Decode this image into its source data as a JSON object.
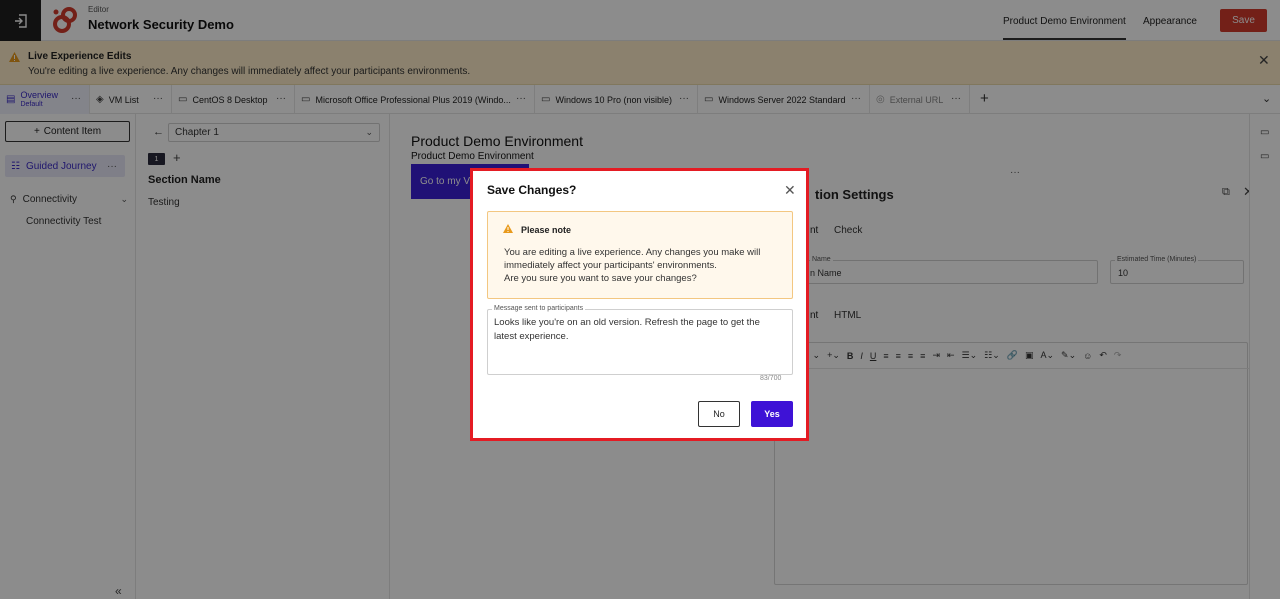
{
  "header": {
    "editor_label": "Editor",
    "title": "Network Security Demo",
    "tabs": [
      "Product Demo Environment",
      "Appearance"
    ],
    "save_label": "Save",
    "save_color": "#d13b2c"
  },
  "banner": {
    "title": "Live Experience Edits",
    "text": "You're editing a live experience. Any changes will immediately affect your participants environments."
  },
  "vm_tabs": [
    {
      "label": "Overview",
      "sub": "Default",
      "icon": "home-icon"
    },
    {
      "label": "VM List",
      "icon": "layers-icon"
    },
    {
      "label": "CentOS 8 Desktop",
      "icon": "monitor-icon"
    },
    {
      "label": "Microsoft Office Professional Plus 2019 (Windo...",
      "icon": "monitor-icon"
    },
    {
      "label": "Windows 10 Pro (non visible)",
      "icon": "monitor-icon"
    },
    {
      "label": "Windows Server 2022 Standard",
      "icon": "monitor-icon"
    },
    {
      "label": "External URL",
      "icon": "eye-off-icon"
    }
  ],
  "sidebar": {
    "content_button": "Content Item",
    "guided_journey": "Guided Journey",
    "connectivity": "Connectivity",
    "connectivity_test": "Connectivity Test"
  },
  "chapter": {
    "select_value": "Chapter 1",
    "page_number": "1",
    "section_label": "Section Name",
    "section_value": "Testing"
  },
  "preview": {
    "title": "Product Demo Environment",
    "subtitle": "Product Demo Environment",
    "button": "Go to my V"
  },
  "settings": {
    "title": "tion Settings",
    "tabs1": [
      "nt",
      "Check"
    ],
    "name_label": "Name",
    "name_value": "n Name",
    "est_label": "Estimated Time (Minutes)",
    "est_value": "10",
    "tabs2": [
      "nt",
      "HTML"
    ],
    "font_size": "5px"
  },
  "modal": {
    "title": "Save Changes?",
    "note_title": "Please note",
    "note_line1": "You are editing a live experience. Any changes you make will",
    "note_line2": "immediately affect your participants' environments.",
    "note_line3": "Are you sure you want to save your changes?",
    "message_label": "Message sent to participants",
    "message_value": "Looks like you're on an old version. Refresh the page to get the latest experience.",
    "counter": "83/700",
    "no_label": "No",
    "yes_label": "Yes",
    "highlight_color": "#e41b23",
    "accent_color": "#3e12d6"
  }
}
